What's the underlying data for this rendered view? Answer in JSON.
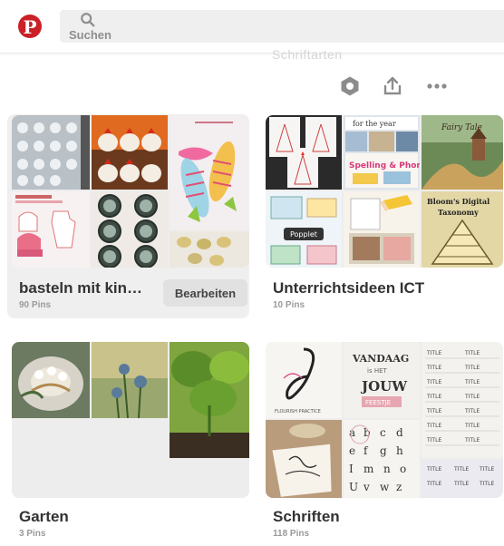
{
  "header": {
    "logo_letter": "P",
    "search_placeholder": "Suchen",
    "ghost_text": "Schriftarten"
  },
  "toolbar": {
    "icons": [
      "settings-hexagon-icon",
      "share-upload-icon",
      "more-dots-icon"
    ]
  },
  "boards": [
    {
      "title": "basteln mit kin…",
      "count": "90 Pins",
      "edit_label": "Bearbeiten"
    },
    {
      "title": "Unterrichtsideen ICT",
      "count": "10 Pins"
    },
    {
      "title": "Garten",
      "count": "3 Pins"
    },
    {
      "title": "Schriften",
      "count": "118 Pins"
    }
  ],
  "cover_text": {
    "fairy_tale": "Fairy Tale",
    "spelling": "Spelling & Phonics",
    "blooms": "Bloom's Digital Taxonomy",
    "popplet": "Popplet",
    "vandaag": "VANDAAG",
    "is_het": "is HET",
    "jouw": "JOUW",
    "feestje": "FEESTJE",
    "title_word": "TITLE",
    "flourish": "FLOURISH PRACTICE"
  },
  "colors": {
    "pinterest_red": "#cb2027",
    "card_bg": "#efefef",
    "text_dark": "#333333",
    "text_muted": "#9a9a9a"
  }
}
